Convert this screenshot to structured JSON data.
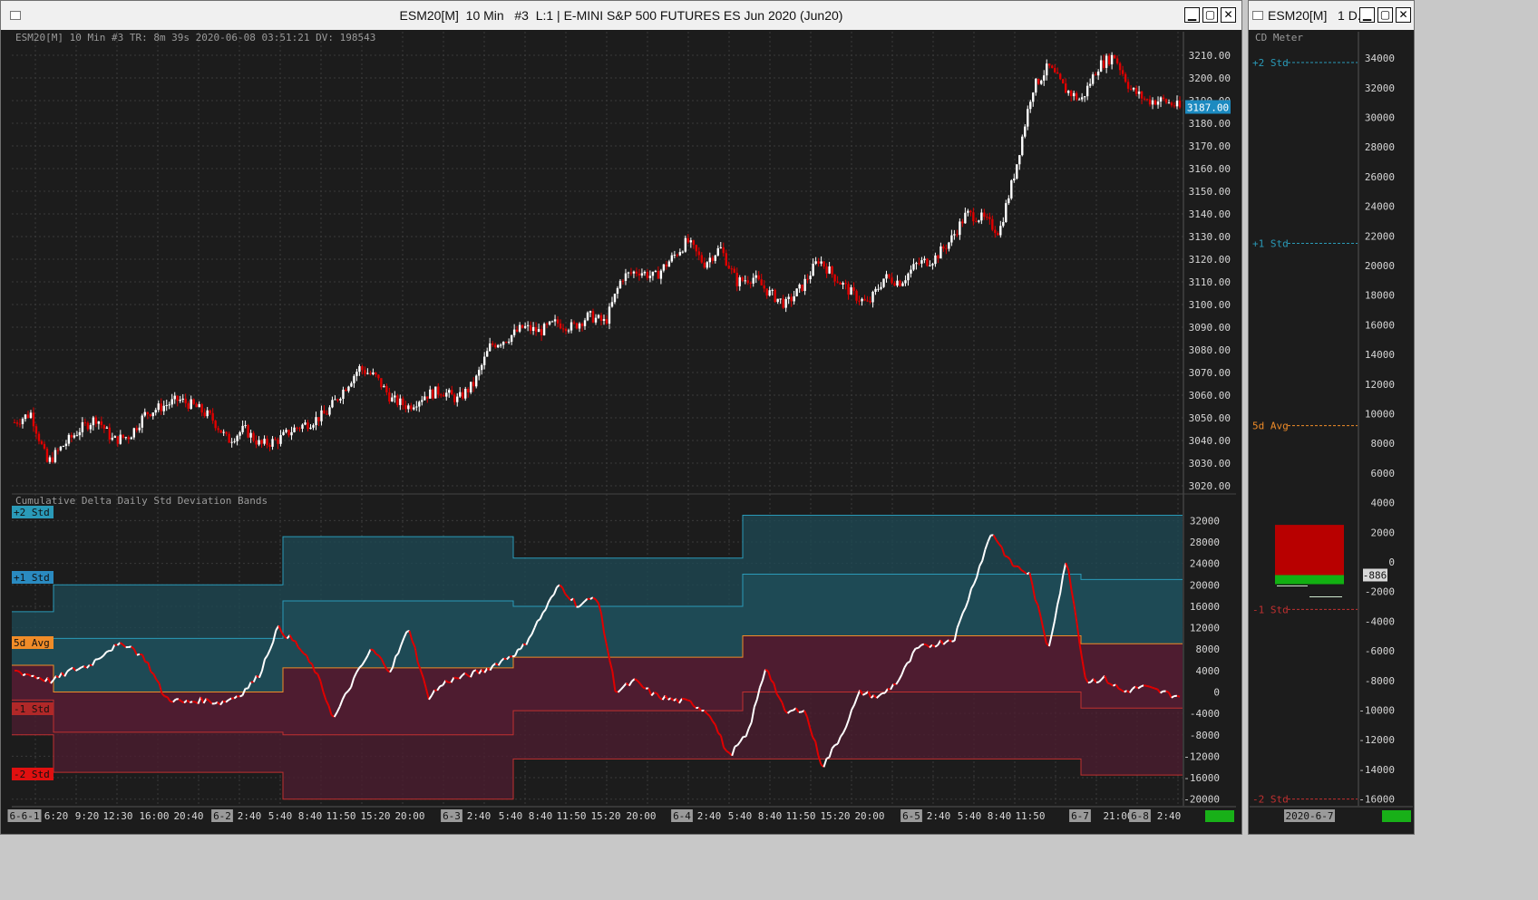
{
  "main_window": {
    "title": "ESM20[M]  10 Min   #3  L:1 | E-MINI S&P 500 FUTURES ES Jun 2020 (Jun20)",
    "buttons": [
      "▁",
      "▢",
      "✕"
    ]
  },
  "side_window": {
    "title": "ESM20[M]   1 D...",
    "buttons": [
      "▁",
      "▢",
      "✕"
    ]
  },
  "colors": {
    "background": "#1c1c1c",
    "up_candle": "#ffffff",
    "down_candle": "#e00000",
    "upper_band": "#1e4a55",
    "lower_band": "#4e1c30",
    "avg_line": "#f08c28",
    "std_line_upper": "#2a9ab8",
    "std_line_lower": "#c03030",
    "last_price_tag": "#1c8ac0"
  },
  "price_pane": {
    "info": "ESM20[M]  10 Min  #3 TR: 8m 39s 2020-06-08 03:51:21 DV: 198543",
    "y_ticks": [
      "3210.00",
      "3200.00",
      "3190.00",
      "3180.00",
      "3170.00",
      "3160.00",
      "3150.00",
      "3140.00",
      "3130.00",
      "3120.00",
      "3110.00",
      "3100.00",
      "3090.00",
      "3080.00",
      "3070.00",
      "3060.00",
      "3050.00",
      "3040.00",
      "3030.00",
      "3020.00"
    ],
    "last_price": "3187.00"
  },
  "delta_pane": {
    "title": "Cumulative Delta Daily Std Deviation Bands",
    "y_ticks": [
      "32000",
      "28000",
      "24000",
      "20000",
      "16000",
      "12000",
      "8000",
      "4000",
      "0",
      "-4000",
      "-8000",
      "-12000",
      "-16000",
      "-20000"
    ],
    "labels": {
      "plus2": "+2 Std",
      "plus1": "+1 Std",
      "avg": "5d Avg",
      "minus1": "-1 Std",
      "minus2": "-2 Std"
    }
  },
  "x_axis": {
    "labels": [
      {
        "text": "6-6-1",
        "boxed": true
      },
      {
        "text": "6:20",
        "boxed": false
      },
      {
        "text": "9:20",
        "boxed": false
      },
      {
        "text": "12:30",
        "boxed": false
      },
      {
        "text": "16:00",
        "boxed": false
      },
      {
        "text": "20:40",
        "boxed": false
      },
      {
        "text": "6-2",
        "boxed": true
      },
      {
        "text": "2:40",
        "boxed": false
      },
      {
        "text": "5:40",
        "boxed": false
      },
      {
        "text": "8:40",
        "boxed": false
      },
      {
        "text": "11:50",
        "boxed": false
      },
      {
        "text": "15:20",
        "boxed": false
      },
      {
        "text": "20:00",
        "boxed": false
      },
      {
        "text": "6-3",
        "boxed": true
      },
      {
        "text": "2:40",
        "boxed": false
      },
      {
        "text": "5:40",
        "boxed": false
      },
      {
        "text": "8:40",
        "boxed": false
      },
      {
        "text": "11:50",
        "boxed": false
      },
      {
        "text": "15:20",
        "boxed": false
      },
      {
        "text": "20:00",
        "boxed": false
      },
      {
        "text": "6-4",
        "boxed": true
      },
      {
        "text": "2:40",
        "boxed": false
      },
      {
        "text": "5:40",
        "boxed": false
      },
      {
        "text": "8:40",
        "boxed": false
      },
      {
        "text": "11:50",
        "boxed": false
      },
      {
        "text": "15:20",
        "boxed": false
      },
      {
        "text": "20:00",
        "boxed": false
      },
      {
        "text": "6-5",
        "boxed": true
      },
      {
        "text": "2:40",
        "boxed": false
      },
      {
        "text": "5:40",
        "boxed": false
      },
      {
        "text": "8:40",
        "boxed": false
      },
      {
        "text": "11:50",
        "boxed": false
      },
      {
        "text": "6-7",
        "boxed": true
      },
      {
        "text": "21:00",
        "boxed": false
      },
      {
        "text": "6-8",
        "boxed": true
      },
      {
        "text": "2:40",
        "boxed": false
      }
    ]
  },
  "meter": {
    "title": "CD Meter",
    "y_ticks": [
      "34000",
      "32000",
      "30000",
      "28000",
      "26000",
      "24000",
      "22000",
      "20000",
      "18000",
      "16000",
      "14000",
      "12000",
      "10000",
      "8000",
      "6000",
      "4000",
      "2000",
      "0",
      "-2000",
      "-4000",
      "-6000",
      "-8000",
      "-10000",
      "-12000",
      "-14000",
      "-16000"
    ],
    "current_value": "-886",
    "date": "2020-6-7",
    "labels": {
      "plus2": "+2 Std",
      "plus1": "+1 Std",
      "avg": "5d Avg",
      "minus1": "-1 Std",
      "minus2": "-2 Std"
    }
  },
  "chart_data": [
    {
      "type": "candlestick",
      "title": "ESM20[M]  10 Min",
      "ylim": [
        3015,
        3215
      ],
      "sessions": [
        "6-1",
        "6-2",
        "6-3",
        "6-4",
        "6-5",
        "6-7",
        "6-8"
      ],
      "close_path_sampled": [
        3048,
        3052,
        3030,
        3038,
        3045,
        3050,
        3040,
        3042,
        3052,
        3055,
        3058,
        3055,
        3050,
        3040,
        3045,
        3038,
        3040,
        3045,
        3048,
        3052,
        3062,
        3072,
        3068,
        3058,
        3055,
        3060,
        3062,
        3058,
        3065,
        3082,
        3085,
        3090,
        3088,
        3092,
        3090,
        3095,
        3092,
        3112,
        3115,
        3112,
        3120,
        3128,
        3118,
        3125,
        3110,
        3112,
        3105,
        3100,
        3108,
        3120,
        3112,
        3105,
        3100,
        3112,
        3110,
        3118,
        3120,
        3128,
        3140,
        3138,
        3132,
        3160,
        3195,
        3205,
        3195,
        3190,
        3205,
        3210,
        3195,
        3190,
        3190,
        3187
      ]
    },
    {
      "type": "line",
      "title": "Cumulative Delta Daily Std Deviation Bands",
      "ylim": [
        -21000,
        33500
      ],
      "bands": [
        {
          "session": "6-1 start",
          "plus2": 15000,
          "plus1": 10000,
          "avg": 5000,
          "minus1": -1500,
          "minus2": -8000
        },
        {
          "session": "6-1",
          "plus2": 20000,
          "plus1": 10000,
          "avg": 0,
          "minus1": -7500,
          "minus2": -15000
        },
        {
          "session": "6-2",
          "plus2": 29000,
          "plus1": 17000,
          "avg": 4500,
          "minus1": -8000,
          "minus2": -20000
        },
        {
          "session": "6-3",
          "plus2": 25000,
          "plus1": 16000,
          "avg": 6500,
          "minus1": -3500,
          "minus2": -12500
        },
        {
          "session": "6-4",
          "plus2": 33000,
          "plus1": 22000,
          "avg": 10500,
          "minus1": 0,
          "minus2": -12500
        },
        {
          "session": "6-7/6-8",
          "plus2": 33000,
          "plus1": 21000,
          "avg": 9000,
          "minus1": -3000,
          "minus2": -15500
        }
      ],
      "delta_path_sampled": [
        4000,
        3000,
        2000,
        4000,
        5000,
        8000,
        9000,
        6000,
        -1000,
        -2000,
        -1500,
        -2000,
        -500,
        3000,
        12000,
        9000,
        4000,
        -5000,
        2000,
        8000,
        4000,
        12000,
        -1000,
        2000,
        3000,
        4000,
        6000,
        8000,
        14000,
        20000,
        16000,
        18000,
        0,
        2000,
        -500,
        -1500,
        -2000,
        -4000,
        -12000,
        -8000,
        5000,
        -4000,
        -3000,
        -14000,
        -8000,
        0,
        -1000,
        2000,
        8000,
        9000,
        10000,
        20000,
        30000,
        24000,
        22000,
        8000,
        25000,
        2000,
        2500,
        0,
        1000,
        0,
        -900
      ]
    },
    {
      "type": "bar",
      "title": "CD Meter",
      "ylim": [
        -17000,
        35000
      ],
      "categories": [
        "2020-6-7"
      ],
      "values": [
        -886
      ],
      "range_high": 2500,
      "range_low": -1500,
      "levels": {
        "plus2": 33700,
        "plus1": 21500,
        "avg": 9200,
        "minus1": -3200,
        "minus2": -16000
      }
    }
  ]
}
